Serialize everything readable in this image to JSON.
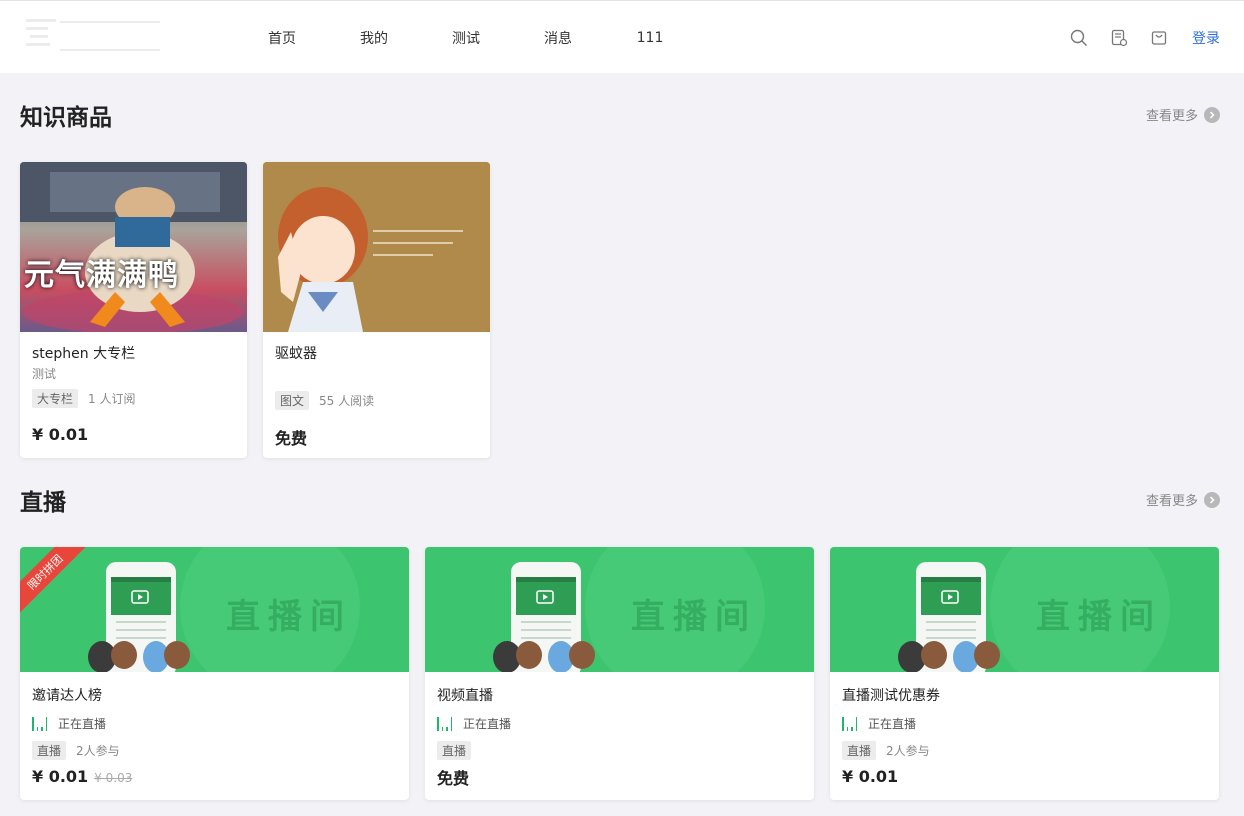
{
  "header": {
    "nav": [
      "首页",
      "我的",
      "测试",
      "消息",
      "111"
    ],
    "login": "登录"
  },
  "knowledge": {
    "title": "知识商品",
    "more": "查看更多",
    "items": [
      {
        "title": "stephen 大专栏",
        "subtitle": "测试",
        "tag": "大专栏",
        "stat": "1 人订阅",
        "price": "¥ 0.01",
        "image_text": "元气满满鸭"
      },
      {
        "title": "驱蚊器",
        "subtitle": "",
        "tag": "图文",
        "stat": "55 人阅读",
        "price": "免费"
      }
    ]
  },
  "live": {
    "title": "直播",
    "more": "查看更多",
    "banner_text": "直播间",
    "status": "正在直播",
    "items": [
      {
        "title": "邀请达人榜",
        "tag": "直播",
        "stat": "2人参与",
        "price": "¥ 0.01",
        "old_price": "¥ 0.03",
        "ribbon": "限时拼团"
      },
      {
        "title": "视频直播",
        "tag": "直播",
        "stat": "",
        "price": "免费",
        "old_price": ""
      },
      {
        "title": "直播测试优惠券",
        "tag": "直播",
        "stat": "2人参与",
        "price": "¥ 0.01",
        "old_price": ""
      }
    ]
  },
  "colors": {
    "accent": "#2f6ee0",
    "live_green": "#3cc46f",
    "ribbon_red": "#e9463b"
  }
}
